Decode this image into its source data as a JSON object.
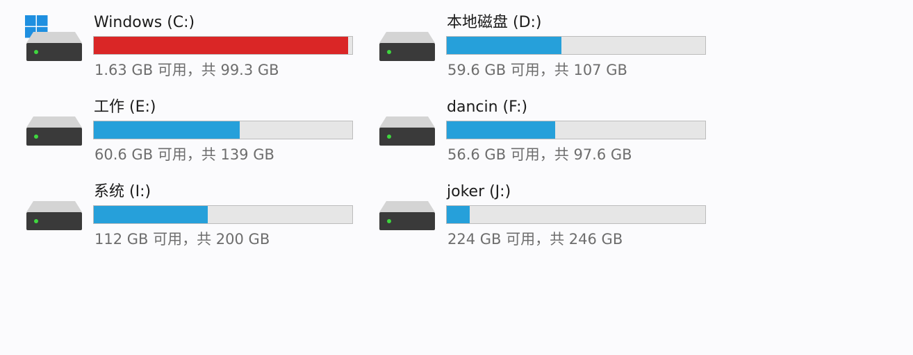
{
  "colors": {
    "normal_fill": "#26a0da",
    "warning_fill": "#da2626",
    "bar_track": "#e6e6e6",
    "windows_logo": "#1e8fe0"
  },
  "drives": [
    {
      "name": "Windows (C:)",
      "space_text": "1.63 GB 可用，共 99.3 GB",
      "free_gb": 1.63,
      "total_gb": 99.3,
      "used_fraction": 0.984,
      "state": "warning",
      "system_drive": true,
      "icon": "hard-drive-icon"
    },
    {
      "name": "本地磁盘 (D:)",
      "space_text": "59.6 GB 可用，共 107 GB",
      "free_gb": 59.6,
      "total_gb": 107,
      "used_fraction": 0.443,
      "state": "normal",
      "system_drive": false,
      "icon": "hard-drive-icon"
    },
    {
      "name": "工作 (E:)",
      "space_text": "60.6 GB 可用，共 139 GB",
      "free_gb": 60.6,
      "total_gb": 139,
      "used_fraction": 0.564,
      "state": "normal",
      "system_drive": false,
      "icon": "hard-drive-icon"
    },
    {
      "name": "dancin (F:)",
      "space_text": "56.6 GB 可用，共 97.6 GB",
      "free_gb": 56.6,
      "total_gb": 97.6,
      "used_fraction": 0.42,
      "state": "normal",
      "system_drive": false,
      "icon": "hard-drive-icon"
    },
    {
      "name": "系统 (I:)",
      "space_text": "112 GB 可用，共 200 GB",
      "free_gb": 112,
      "total_gb": 200,
      "used_fraction": 0.44,
      "state": "normal",
      "system_drive": false,
      "icon": "hard-drive-icon"
    },
    {
      "name": "joker (J:)",
      "space_text": "224 GB 可用，共 246 GB",
      "free_gb": 224,
      "total_gb": 246,
      "used_fraction": 0.089,
      "state": "normal",
      "system_drive": false,
      "icon": "hard-drive-icon"
    }
  ]
}
